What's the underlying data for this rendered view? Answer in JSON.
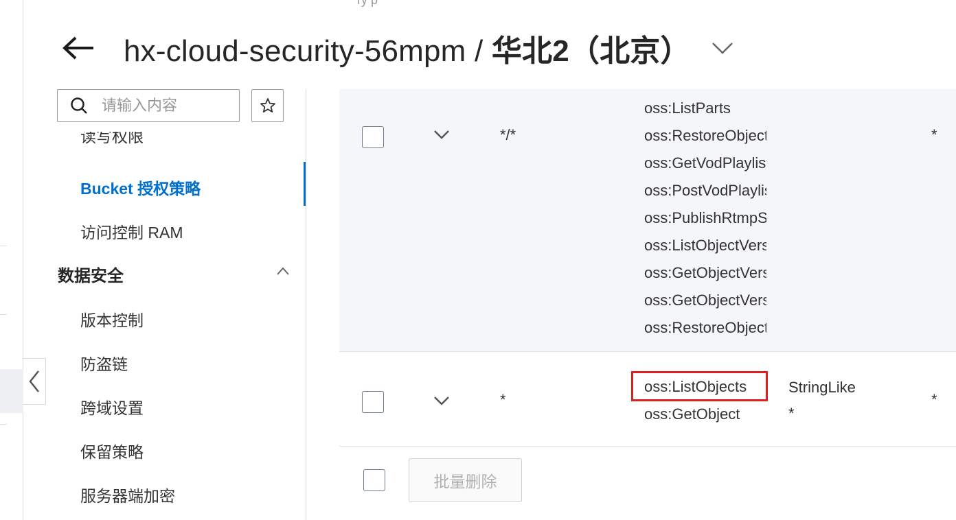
{
  "header": {
    "title_bucket": "hx-cloud-security-56mpm / ",
    "title_region": "华北2（北京）",
    "top_cut_text": "ry p"
  },
  "search": {
    "placeholder": "请输入内容"
  },
  "sidebar": {
    "cut_item": "读写权限",
    "items": [
      {
        "label": "Bucket 授权策略",
        "active": true
      },
      {
        "label": "访问控制 RAM",
        "active": false
      }
    ],
    "group": {
      "label": "数据安全",
      "expanded": true,
      "items": [
        {
          "label": "版本控制"
        },
        {
          "label": "防盗链"
        },
        {
          "label": "跨域设置"
        },
        {
          "label": "保留策略"
        },
        {
          "label": "服务器端加密"
        }
      ]
    }
  },
  "table": {
    "rows": [
      {
        "resource": "*/*",
        "actions": [
          "oss:ListParts",
          "oss:RestoreObject",
          "oss:GetVodPlaylist",
          "oss:PostVodPlaylist",
          "oss:PublishRtmpStream",
          "oss:ListObjectVersions",
          "oss:GetObjectVersion",
          "oss:GetObjectVersionAcl",
          "oss:RestoreObjectVersion"
        ],
        "principal": "*",
        "condition": ""
      },
      {
        "resource": "*",
        "actions": [
          "oss:ListObjects",
          "oss:GetObject"
        ],
        "condition_op": "StringLike",
        "condition_value": "*",
        "principal": "*"
      }
    ],
    "batch_delete_label": "批量删除"
  },
  "colors": {
    "accent": "#0070cc",
    "highlight": "#e02020"
  }
}
